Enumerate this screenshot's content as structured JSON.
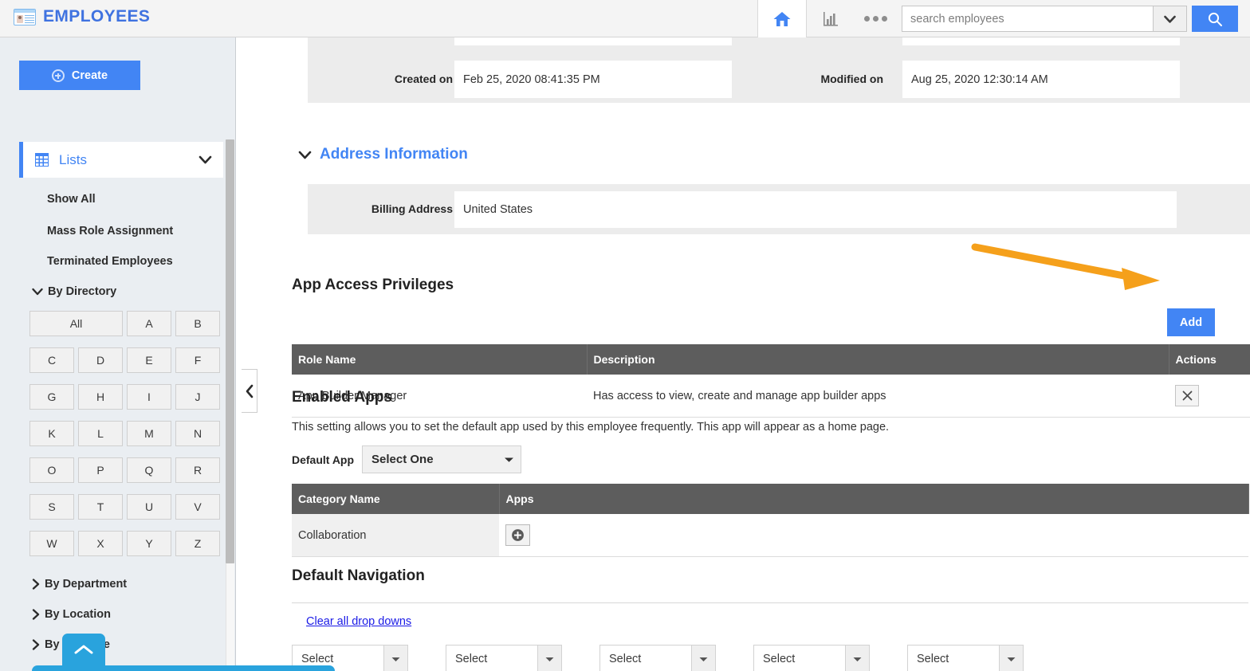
{
  "app": {
    "title": "EMPLOYEES",
    "brand_color": "#3f72e0"
  },
  "topbar": {
    "home_icon": "home-icon",
    "chart_icon": "bar-chart-icon",
    "more_icon": "more-ellipsis-icon",
    "search": {
      "placeholder": "search employees",
      "value": "",
      "dropdown_icon": "chevron-down-icon",
      "button_icon": "search-icon",
      "button_color": "#4285f4"
    }
  },
  "sidebar": {
    "create_label": "Create",
    "create_icon": "plus-circle-icon",
    "lists": {
      "label": "Lists",
      "icon": "grid-icon",
      "chevron": "chevron-down-icon"
    },
    "links": [
      {
        "label": "Show All"
      },
      {
        "label": "Mass Role Assignment"
      },
      {
        "label": "Terminated Employees"
      }
    ],
    "groups": [
      {
        "label": "By Directory",
        "expanded": true,
        "icon": "chevron-down-icon"
      },
      {
        "label": "By Department",
        "expanded": false,
        "icon": "chevron-right-icon"
      },
      {
        "label": "By Location",
        "expanded": false,
        "icon": "chevron-right-icon"
      },
      {
        "label": "By Job Title",
        "expanded": false,
        "icon": "chevron-right-icon"
      }
    ],
    "directory_letters": [
      "All",
      "A",
      "B",
      "C",
      "D",
      "E",
      "F",
      "G",
      "H",
      "I",
      "J",
      "K",
      "L",
      "M",
      "N",
      "O",
      "P",
      "Q",
      "R",
      "S",
      "T",
      "U",
      "V",
      "W",
      "X",
      "Y",
      "Z"
    ],
    "collapse_icon": "chevron-left-icon",
    "fab_icon": "chevron-up-icon",
    "fab_color": "#29a3dd"
  },
  "main": {
    "record_meta": {
      "created_label": "Created on",
      "created_value": "Feb 25, 2020 08:41:35 PM",
      "modified_label": "Modified on",
      "modified_value": "Aug 25, 2020 12:30:14 AM"
    },
    "address_section": {
      "title": "Address Information",
      "chevron": "chevron-down-icon",
      "billing_label": "Billing Address",
      "billing_value": "United States"
    },
    "app_access": {
      "title": "App Access Privileges",
      "add_label": "Add",
      "add_color": "#4285f4",
      "columns": [
        "Role Name",
        "Description",
        "Actions"
      ],
      "rows": [
        {
          "role": "App Builder Manager",
          "description": "Has access to view, create and manage app builder apps",
          "action_icon": "close-x-icon"
        }
      ]
    },
    "enabled_apps": {
      "title": "Enabled Apps",
      "description": "This setting allows you to set the default app used by this employee frequently. This app will appear as a home page.",
      "default_app_label": "Default App",
      "default_app_value": "Select One",
      "columns": [
        "Category Name",
        "Apps"
      ],
      "rows": [
        {
          "category": "Collaboration",
          "apps_icon": "plus-circle-icon"
        }
      ]
    },
    "default_navigation": {
      "title": "Default Navigation",
      "clear_link": "Clear all drop downs",
      "selects": [
        "Select",
        "Select",
        "Select",
        "Select",
        "Select"
      ]
    }
  },
  "annotation": {
    "arrow_color": "#f5a01b",
    "points_to": "add-button"
  }
}
